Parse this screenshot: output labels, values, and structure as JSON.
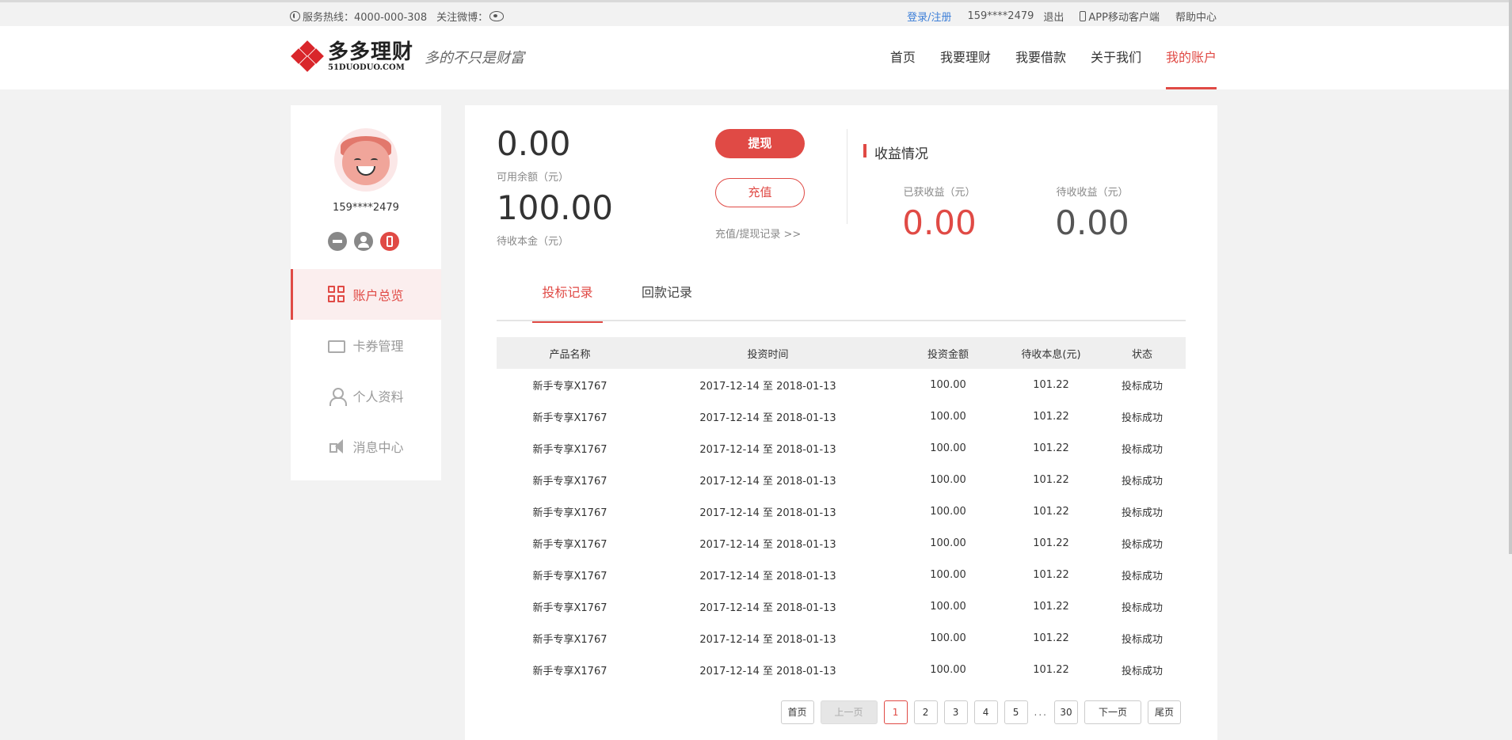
{
  "topbar": {
    "hotline": "服务热线：4000-000-308",
    "follow_weibo": "关注微博：",
    "login_register": "登录/注册",
    "user": "159****2479",
    "logout": "退出",
    "app": "APP移动客户端",
    "help": "帮助中心"
  },
  "header": {
    "logo_cn": "多多理财",
    "logo_en": "51DUODUO.COM",
    "slogan": "多的不只是财富",
    "nav": [
      "首页",
      "我要理财",
      "我要借款",
      "关于我们",
      "我的账户"
    ],
    "active_nav": "我的账户"
  },
  "sidebar": {
    "username": "159****2479",
    "menu": [
      "账户总览",
      "卡券管理",
      "个人资料",
      "消息中心"
    ]
  },
  "account": {
    "available_balance": "0.00",
    "available_label": "可用余额（元）",
    "pending_principal": "100.00",
    "pending_principal_label": "待收本金（元）",
    "withdraw_button": "提现",
    "recharge_button": "充值",
    "records_link": "充值/提现记录 >>"
  },
  "income": {
    "title": "收益情况",
    "earned_label": "已获收益（元）",
    "earned_value": "0.00",
    "pending_label": "待收收益（元）",
    "pending_value": "0.00"
  },
  "tabs": [
    "投标记录",
    "回款记录"
  ],
  "table": {
    "headers": [
      "产品名称",
      "投资时间",
      "投资金额",
      "待收本息(元)",
      "状态"
    ],
    "rows": [
      [
        "新手专享X1767",
        "2017-12-14 至 2018-01-13",
        "100.00",
        "101.22",
        "投标成功"
      ],
      [
        "新手专享X1767",
        "2017-12-14 至 2018-01-13",
        "100.00",
        "101.22",
        "投标成功"
      ],
      [
        "新手专享X1767",
        "2017-12-14 至 2018-01-13",
        "100.00",
        "101.22",
        "投标成功"
      ],
      [
        "新手专享X1767",
        "2017-12-14 至 2018-01-13",
        "100.00",
        "101.22",
        "投标成功"
      ],
      [
        "新手专享X1767",
        "2017-12-14 至 2018-01-13",
        "100.00",
        "101.22",
        "投标成功"
      ],
      [
        "新手专享X1767",
        "2017-12-14 至 2018-01-13",
        "100.00",
        "101.22",
        "投标成功"
      ],
      [
        "新手专享X1767",
        "2017-12-14 至 2018-01-13",
        "100.00",
        "101.22",
        "投标成功"
      ],
      [
        "新手专享X1767",
        "2017-12-14 至 2018-01-13",
        "100.00",
        "101.22",
        "投标成功"
      ],
      [
        "新手专享X1767",
        "2017-12-14 至 2018-01-13",
        "100.00",
        "101.22",
        "投标成功"
      ],
      [
        "新手专享X1767",
        "2017-12-14 至 2018-01-13",
        "100.00",
        "101.22",
        "投标成功"
      ]
    ]
  },
  "pager": {
    "first": "首页",
    "prev": "上一页",
    "pages": [
      "1",
      "2",
      "3",
      "4",
      "5"
    ],
    "dots": "...",
    "last_page": "30",
    "next": "下一页",
    "last": "尾页"
  },
  "colors": {
    "accent": "#e04a45",
    "link": "#3d7fd8"
  }
}
